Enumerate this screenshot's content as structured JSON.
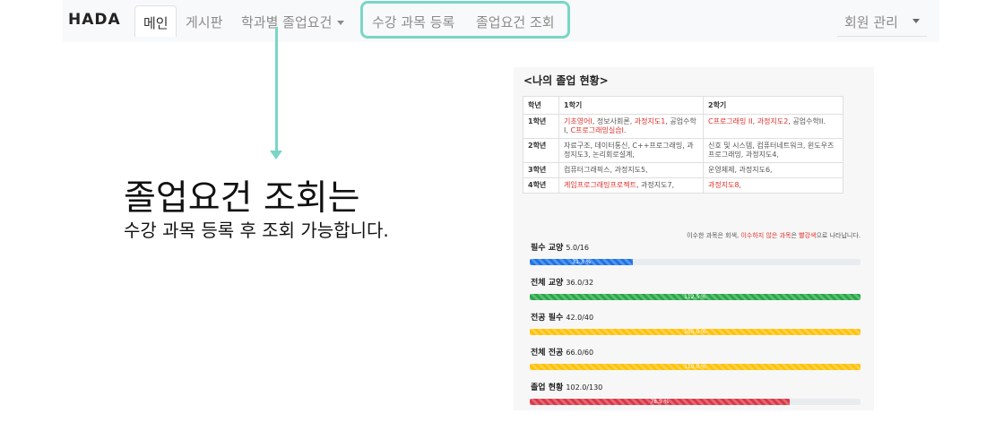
{
  "navbar": {
    "brand": "HADA",
    "items": [
      "메인",
      "게시판",
      "학과별 졸업요건",
      "수강 과목 등록",
      "졸업요건 조회"
    ],
    "member_menu": "회원 관리"
  },
  "callout": {
    "title": "졸업요건 조회는",
    "subtitle": "수강 과목 등록 후 조회 가능합니다."
  },
  "panel": {
    "title": "<나의 졸업 현황>",
    "headers": [
      "학년",
      "1학기",
      "2학기"
    ],
    "rows": [
      {
        "year": "1학년",
        "sem1": [
          {
            "t": "기초영어I",
            "red": true
          },
          {
            "t": ", 정보사회론, ",
            "red": false
          },
          {
            "t": "과정지도1",
            "red": true
          },
          {
            "t": ", 공업수학I, ",
            "red": false
          },
          {
            "t": "C프로그래밍실습I",
            "red": true
          },
          {
            "t": ".",
            "red": false
          }
        ],
        "sem2": [
          {
            "t": "C프로그래밍 II",
            "red": true
          },
          {
            "t": ", ",
            "red": false
          },
          {
            "t": "과정지도2",
            "red": true
          },
          {
            "t": ", 공업수학II.",
            "red": false
          }
        ]
      },
      {
        "year": "2학년",
        "sem1": [
          {
            "t": "자료구조, 데이터통신, C++프로그래밍, 과정지도3, 논리회로설계,",
            "red": false
          }
        ],
        "sem2": [
          {
            "t": "신호 및 시스템, 컴퓨터네트워크, 윈도우즈프로그래밍, 과정지도4,",
            "red": false
          }
        ]
      },
      {
        "year": "3학년",
        "sem1": [
          {
            "t": "컴퓨터그래픽스, 과정지도5,",
            "red": false
          }
        ],
        "sem2": [
          {
            "t": "운영체제, 과정지도6,",
            "red": false
          }
        ]
      },
      {
        "year": "4학년",
        "sem1": [
          {
            "t": "게임프로그래밍프로젝트",
            "red": true
          },
          {
            "t": ", 과정지도7,",
            "red": false
          }
        ],
        "sem2": [
          {
            "t": "과정지도8",
            "red": true
          },
          {
            "t": ",",
            "red": false
          }
        ]
      }
    ],
    "note": [
      {
        "t": "이수한 과목은 회색, ",
        "red": false
      },
      {
        "t": "이수하지 않은 과목",
        "red": true
      },
      {
        "t": "은 ",
        "red": false
      },
      {
        "t": "빨강색",
        "red": true
      },
      {
        "t": "으로 나타납니다.",
        "red": false
      }
    ],
    "progress": [
      {
        "label": "필수 교양",
        "value": "5.0/16",
        "percent_text": "31.3 %",
        "percent": 31.3,
        "color": "#1b73e8"
      },
      {
        "label": "전체 교양",
        "value": "36.0/32",
        "percent_text": "112.5 %",
        "percent": 112.5,
        "color": "#28a745"
      },
      {
        "label": "전공 필수",
        "value": "42.0/40",
        "percent_text": "105.0 %",
        "percent": 105.0,
        "color": "#ffc107"
      },
      {
        "label": "전체 전공",
        "value": "66.0/60",
        "percent_text": "110.0 %",
        "percent": 110.0,
        "color": "#ffc107"
      },
      {
        "label": "졸업 현황",
        "value": "102.0/130",
        "percent_text": "78.5 %",
        "percent": 78.5,
        "color": "#dc3545"
      }
    ]
  }
}
